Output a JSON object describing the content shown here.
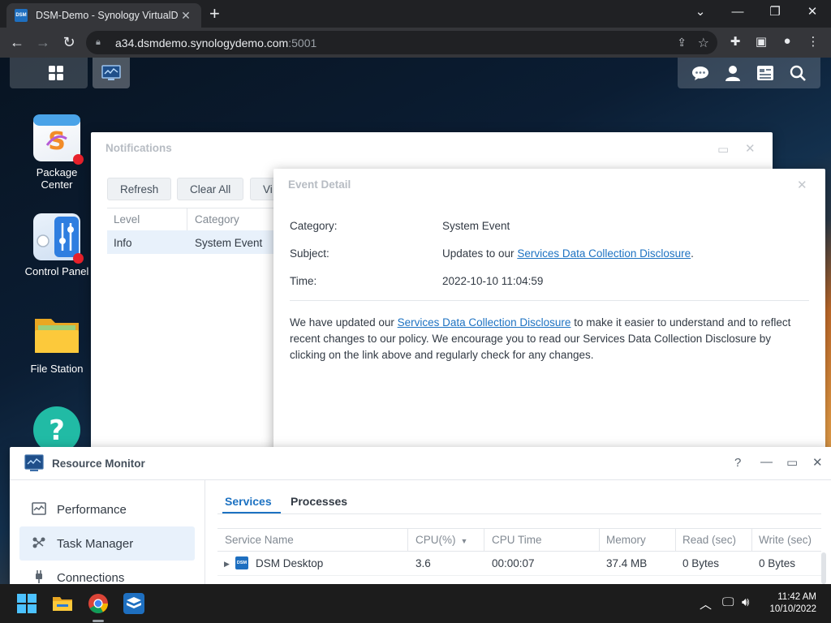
{
  "browser": {
    "tab_title": "DSM-Demo - Synology VirtualDS",
    "tab_favicon_text": "DSM",
    "new_tab": "+",
    "url_host": "a34.dsmdemo.synologydemo.com",
    "url_port": ":5001"
  },
  "desktop": {
    "icons": [
      {
        "label_line1": "Package",
        "label_line2": "Center",
        "badge": true
      },
      {
        "label_line1": "Control Panel",
        "label_line2": "",
        "badge": true
      },
      {
        "label_line1": "File Station",
        "label_line2": "",
        "badge": false
      },
      {
        "label_line1": "",
        "label_line2": "",
        "badge": false
      }
    ]
  },
  "notifications": {
    "title": "Notifications",
    "buttons": {
      "refresh": "Refresh",
      "clear_all": "Clear All",
      "view": "Vi"
    },
    "columns": {
      "level": "Level",
      "category": "Category"
    },
    "rows": [
      {
        "level": "Info",
        "category": "System Event"
      }
    ]
  },
  "event_detail": {
    "title": "Event Detail",
    "category_label": "Category:",
    "category_value": "System Event",
    "subject_label": "Subject:",
    "subject_prefix": "Updates to our ",
    "subject_link": "Services Data Collection Disclosure",
    "subject_suffix": ".",
    "time_label": "Time:",
    "time_value": "2022-10-10 11:04:59",
    "body_prefix": "We have updated our ",
    "body_link": "Services Data Collection Disclosure",
    "body_rest": " to make it easier to understand and to reflect recent changes to our policy. We encourage you to read our Services Data Collection Disclosure by clicking on the link above and regularly check for any changes."
  },
  "resource_monitor": {
    "title": "Resource Monitor",
    "help": "?",
    "sidebar": [
      {
        "label": "Performance",
        "active": false
      },
      {
        "label": "Task Manager",
        "active": true
      },
      {
        "label": "Connections",
        "active": false
      }
    ],
    "tabs": {
      "services": "Services",
      "processes": "Processes"
    },
    "columns": {
      "service_name": "Service Name",
      "cpu": "CPU(%)",
      "cpu_time": "CPU Time",
      "memory": "Memory",
      "read": "Read (sec)",
      "write": "Write (sec)"
    },
    "rows": [
      {
        "icon_text": "DSM",
        "name": "DSM Desktop",
        "cpu": "3.6",
        "cpu_time": "00:00:07",
        "memory": "37.4 MB",
        "read": "0 Bytes",
        "write": "0 Bytes"
      }
    ]
  },
  "taskbar": {
    "time": "11:42 AM",
    "date": "10/10/2022"
  },
  "colors": {
    "accent": "#1d72c2",
    "badge": "#e8212b",
    "selected_row": "#e8f1fb"
  }
}
